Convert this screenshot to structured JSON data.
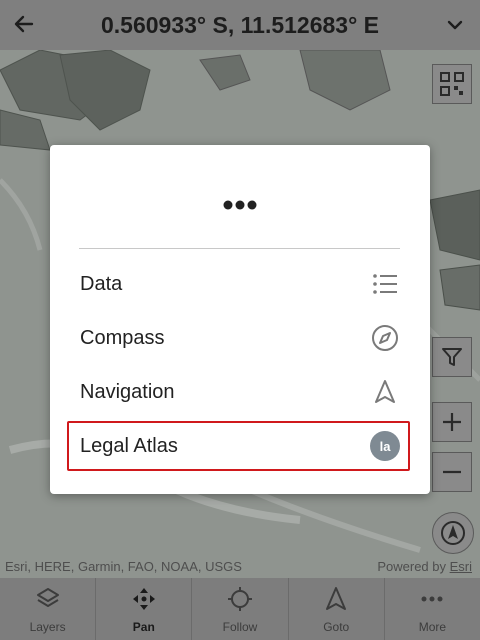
{
  "header": {
    "title": "0.560933° S, 11.512683° E",
    "back_icon": "arrow-left-icon",
    "collapse_icon": "chevron-down-icon"
  },
  "map": {
    "attribution": "Esri, HERE, Garmin, FAO, NOAA, USGS",
    "powered_by_prefix": "Powered by ",
    "powered_by_link": "Esri",
    "tools": [
      "qr-scan-icon",
      "filter-icon",
      "zoom-in-icon",
      "zoom-out-icon",
      "locate-icon"
    ]
  },
  "menu": {
    "header_icon": "more-horizontal-icon",
    "items": [
      {
        "label": "Data",
        "icon": "list-icon"
      },
      {
        "label": "Compass",
        "icon": "compass-icon"
      },
      {
        "label": "Navigation",
        "icon": "navigation-arrow-icon"
      },
      {
        "label": "Legal Atlas",
        "icon": "legal-atlas-logo-icon",
        "logo_text": "la"
      }
    ],
    "highlight_color": "#d0191c"
  },
  "bottom_nav": {
    "items": [
      {
        "label": "Layers",
        "icon": "layers-icon",
        "active": false
      },
      {
        "label": "Pan",
        "icon": "pan-icon",
        "active": true
      },
      {
        "label": "Follow",
        "icon": "crosshair-icon",
        "active": false
      },
      {
        "label": "Goto",
        "icon": "navigation-arrow-icon",
        "active": false
      },
      {
        "label": "More",
        "icon": "more-horizontal-icon",
        "active": false
      }
    ]
  }
}
